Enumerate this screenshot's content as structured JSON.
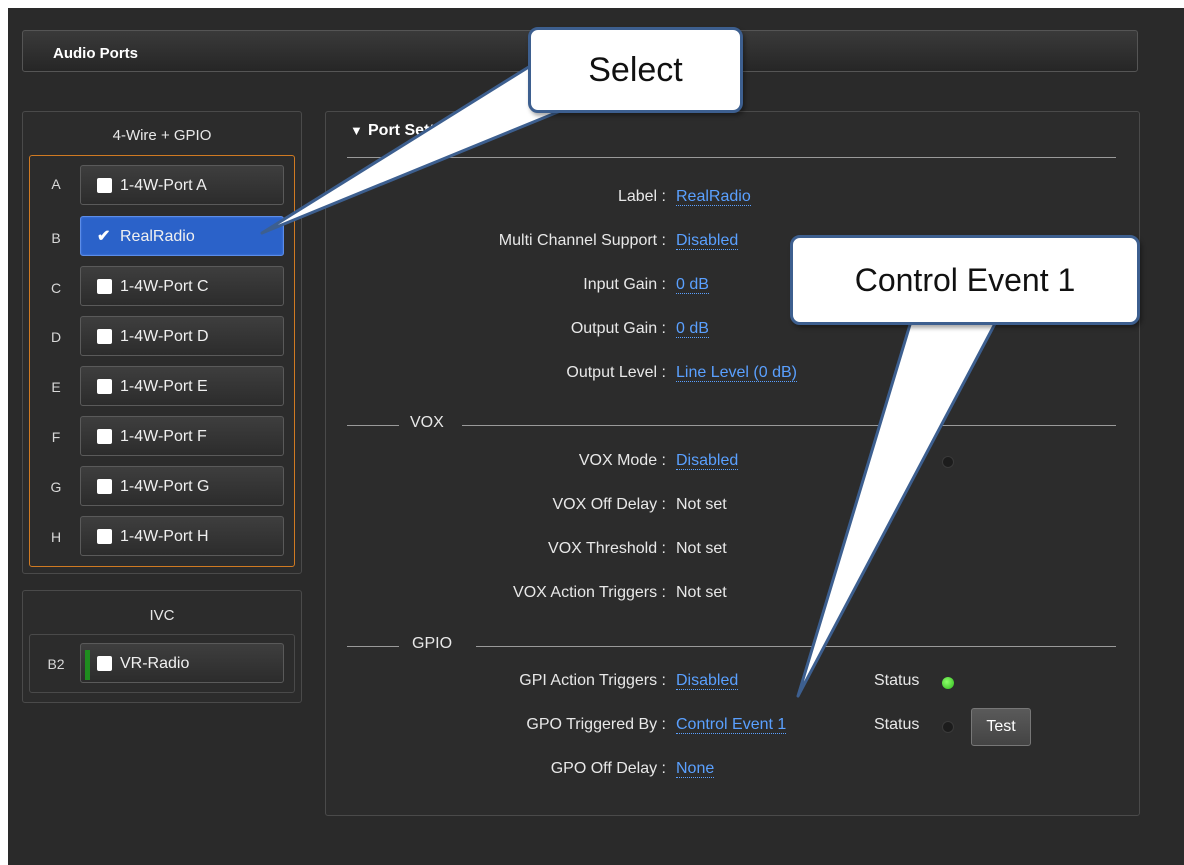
{
  "header": {
    "title": "Audio Ports"
  },
  "four_wire": {
    "title": "4-Wire + GPIO",
    "ports": [
      {
        "letter": "A",
        "label": "1-4W-Port A",
        "selected": false
      },
      {
        "letter": "B",
        "label": "RealRadio",
        "selected": true
      },
      {
        "letter": "C",
        "label": "1-4W-Port C",
        "selected": false
      },
      {
        "letter": "D",
        "label": "1-4W-Port D",
        "selected": false
      },
      {
        "letter": "E",
        "label": "1-4W-Port E",
        "selected": false
      },
      {
        "letter": "F",
        "label": "1-4W-Port F",
        "selected": false
      },
      {
        "letter": "G",
        "label": "1-4W-Port G",
        "selected": false
      },
      {
        "letter": "H",
        "label": "1-4W-Port H",
        "selected": false
      }
    ]
  },
  "ivc": {
    "title": "IVC",
    "ports": [
      {
        "letter": "B2",
        "label": "VR-Radio"
      }
    ]
  },
  "port_settings": {
    "heading": "Port Settings",
    "fields": [
      {
        "label": "Label :",
        "value": "RealRadio"
      },
      {
        "label": "Multi Channel Support :",
        "value": "Disabled"
      },
      {
        "label": "Input Gain :",
        "value": "0 dB"
      },
      {
        "label": "Output Gain :",
        "value": "0 dB"
      },
      {
        "label": "Output Level :",
        "value": "Line Level (0 dB)"
      }
    ],
    "vox": {
      "title": "VOX",
      "fields": [
        {
          "label": "VOX Mode :",
          "value": "Disabled"
        },
        {
          "label": "VOX Off Delay :",
          "value": "Not set"
        },
        {
          "label": "VOX Threshold :",
          "value": "Not set"
        },
        {
          "label": "VOX Action Triggers :",
          "value": "Not set"
        }
      ]
    },
    "gpio": {
      "title": "GPIO",
      "fields": [
        {
          "label": "GPI Action Triggers :",
          "value": "Disabled",
          "status": "Status"
        },
        {
          "label": "GPO Triggered By :",
          "value": "Control Event 1",
          "status": "Status"
        },
        {
          "label": "GPO Off Delay :",
          "value": "None"
        }
      ],
      "test_label": "Test"
    }
  },
  "callouts": {
    "select": "Select",
    "control_event": "Control Event 1"
  },
  "colors": {
    "background": "#2a2a2a",
    "accent_orange": "#d07a22",
    "selected_blue": "#2b62c9",
    "link_blue": "#5aa0ff",
    "status_green": "#2fb81c"
  }
}
